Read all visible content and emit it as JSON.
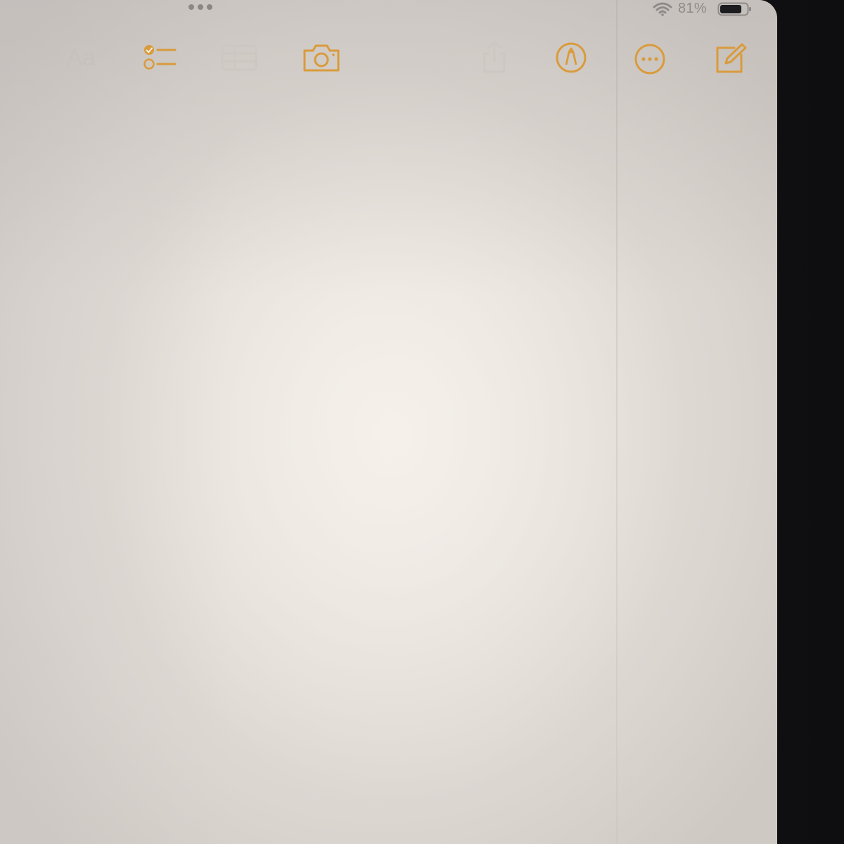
{
  "status_bar": {
    "battery_percent": "81%",
    "battery_level": 0.81,
    "wifi_icon": "wifi-icon",
    "multitask_icon": "multitask-dots-icon"
  },
  "toolbar": {
    "format_label": "Aa",
    "icons": {
      "checklist": "checklist-icon",
      "table": "table-icon",
      "camera": "camera-icon",
      "share": "share-icon",
      "markup": "markup-pen-icon",
      "more": "more-options-icon",
      "compose": "compose-icon"
    }
  },
  "colors": {
    "accent": "#d99b3c",
    "inactive": "#c9c3be",
    "screen_bg": "#ede7e1",
    "bezel": "#141417"
  }
}
